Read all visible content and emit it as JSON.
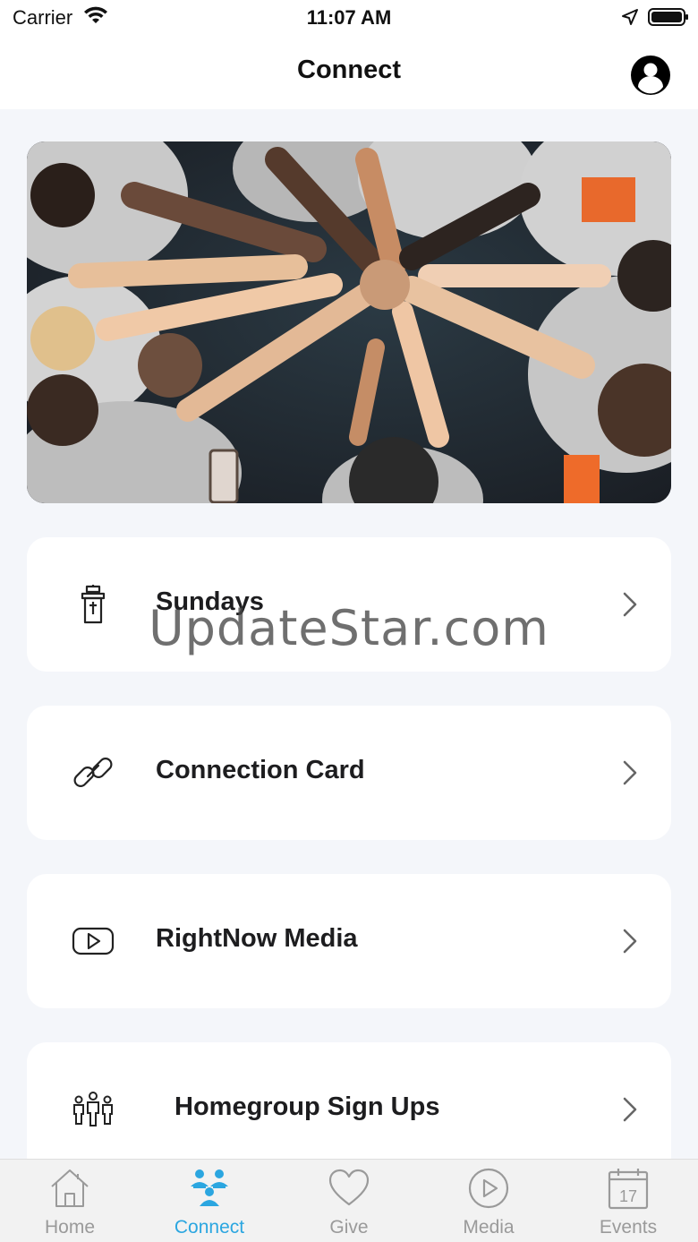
{
  "status_bar": {
    "carrier": "Carrier",
    "time": "11:07 AM",
    "icons": [
      "wifi-icon",
      "location-arrow-icon",
      "battery-icon"
    ]
  },
  "nav": {
    "title": "Connect",
    "right_icon": "profile-icon"
  },
  "hero": {
    "description_icon": "hands-together-photo"
  },
  "menu": [
    {
      "label": "Sundays",
      "icon": "lighthouse-icon"
    },
    {
      "label": "Connection Card",
      "icon": "link-icon"
    },
    {
      "label": "RightNow Media",
      "icon": "video-play-icon"
    },
    {
      "label": "Homegroup Sign Ups",
      "icon": "group-people-icon"
    }
  ],
  "watermark": "UpdateStar.com",
  "tabs": [
    {
      "label": "Home",
      "icon": "home-icon",
      "active": false
    },
    {
      "label": "Connect",
      "icon": "connect-people-icon",
      "active": true
    },
    {
      "label": "Give",
      "icon": "heart-icon",
      "active": false
    },
    {
      "label": "Media",
      "icon": "play-circle-icon",
      "active": false
    },
    {
      "label": "Events",
      "icon": "calendar-icon",
      "active": false
    }
  ],
  "calendar_day": "17",
  "colors": {
    "accent": "#2ba6e0",
    "background": "#f4f6fa",
    "card": "#ffffff",
    "inactive_tab": "#9a9a9a"
  }
}
